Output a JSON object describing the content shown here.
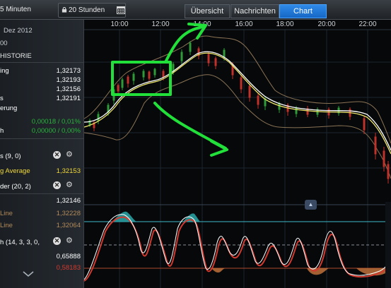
{
  "toolbar": {
    "interval_label": "5 Minuten",
    "range_label": "20 Stunden",
    "tabs": [
      {
        "label": "Übersicht"
      },
      {
        "label": "Nachrichten"
      },
      {
        "label": "Chart"
      }
    ],
    "active_tab": "Chart"
  },
  "left_panel": {
    "date_label": "Dez 2012",
    "small_label": "00",
    "history_label": "HISTORIE",
    "rows": [
      {
        "label": "ing",
        "value": "1,32173"
      },
      {
        "label": "",
        "value": "1,32193"
      },
      {
        "label": "",
        "value": "1,32156"
      },
      {
        "label": "s",
        "value": "1,32191"
      },
      {
        "label": "erung",
        "value": ""
      },
      {
        "label": "",
        "value": "0,00018 / 0,01%"
      },
      {
        "label": "h",
        "value": "0,00000 / 0,00%"
      }
    ],
    "indicators": [
      {
        "label": "s (9, 0)",
        "value": ""
      },
      {
        "label": "g Average",
        "value": "1,32153"
      },
      {
        "label": "der (20, 2)",
        "value": ""
      },
      {
        "label": "",
        "value": "1,32146"
      },
      {
        "label": "Line",
        "value": "1,32228"
      },
      {
        "label": "Line",
        "value": "1,32064"
      },
      {
        "label": "h (14, 3, 3, 0,",
        "value": ""
      },
      {
        "label": "",
        "value": "0,65888"
      },
      {
        "label": "",
        "value": "0,58183"
      }
    ]
  },
  "chart": {
    "time_labels": [
      "10:00",
      "12:00",
      "14:00",
      "16:00",
      "18:00",
      "20:00",
      "22:00"
    ],
    "colors": {
      "price_upper_band": "#8a7355",
      "moving_average_white": "#ffffff",
      "moving_average_yellow": "#f0e86a",
      "candle_up": "#2e9a38",
      "candle_down": "#c0312a",
      "annotation": "#22e03a",
      "stoch_k": "#ffffff",
      "stoch_d": "#d23a2f",
      "upper_line": "#3fb7c9",
      "lower_line": "#b04a2e"
    }
  }
}
